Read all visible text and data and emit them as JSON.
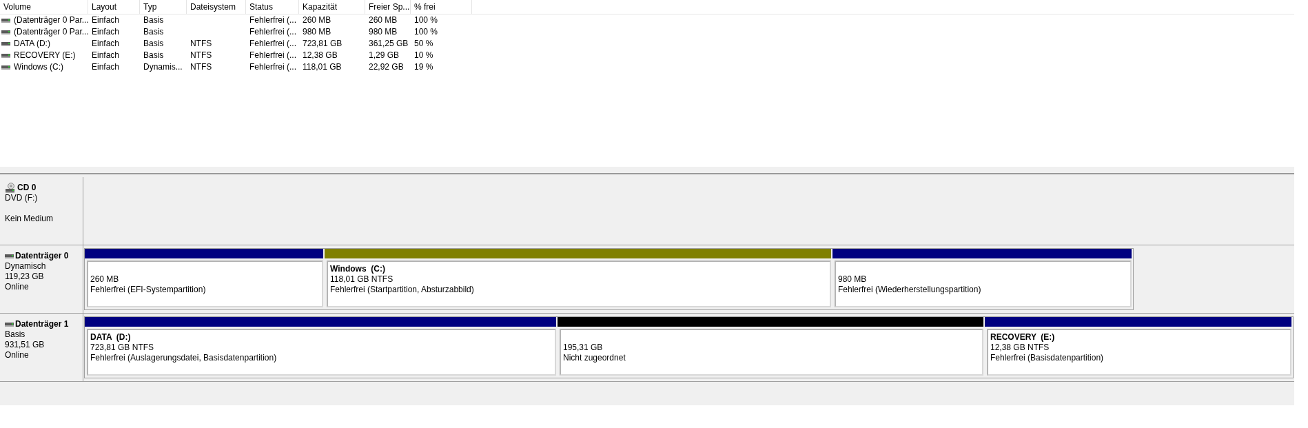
{
  "volume_table": {
    "columns": [
      "Volume",
      "Layout",
      "Typ",
      "Dateisystem",
      "Status",
      "Kapazität",
      "Freier Sp...",
      "% frei"
    ],
    "rows": [
      {
        "volume": "(Datenträger 0 Par...",
        "layout": "Einfach",
        "typ": "Basis",
        "status": "Fehlerfrei (...",
        "kapazitaet": "260 MB",
        "freier_speicher": "260 MB",
        "prozent_frei": "100 %"
      },
      {
        "volume": "(Datenträger 0 Par...",
        "layout": "Einfach",
        "typ": "Basis",
        "status": "Fehlerfrei (...",
        "kapazitaet": "980 MB",
        "freier_speicher": "980 MB",
        "prozent_frei": "100 %"
      },
      {
        "volume": "DATA (D:)",
        "layout": "Einfach",
        "typ": "Basis",
        "dateisystem": "NTFS",
        "status": "Fehlerfrei (...",
        "kapazitaet": "723,81 GB",
        "freier_speicher": "361,25 GB",
        "prozent_frei": "50 %"
      },
      {
        "volume": "RECOVERY (E:)",
        "layout": "Einfach",
        "typ": "Basis",
        "dateisystem": "NTFS",
        "status": "Fehlerfrei (...",
        "kapazitaet": "12,38 GB",
        "freier_speicher": "1,29 GB",
        "prozent_frei": "10 %"
      },
      {
        "volume": "Windows (C:)",
        "layout": "Einfach",
        "typ": "Dynamis...",
        "dateisystem": "NTFS",
        "status": "Fehlerfrei (...",
        "kapazitaet": "118,01 GB",
        "freier_speicher": "22,92 GB",
        "prozent_frei": "19 %"
      }
    ]
  },
  "disks": [
    {
      "kind": "cd",
      "name": "CD 0",
      "type": "DVD (F:)",
      "status": "Kein Medium"
    },
    {
      "kind": "disk",
      "name": "Datenträger 0",
      "type": "Dynamisch",
      "size": "119,23 GB",
      "status": "Online",
      "partitions": [
        {
          "color": "#000080",
          "size": "260 MB",
          "status": "Fehlerfrei (EFI-Systempartition)"
        },
        {
          "color": "#808000",
          "name": "Windows  (C:)",
          "size": "118,01 GB NTFS",
          "status": "Fehlerfrei (Startpartition, Absturzabbild)"
        },
        {
          "color": "#000080",
          "size": "980 MB",
          "status": "Fehlerfrei (Wiederherstellungspartition)"
        }
      ]
    },
    {
      "kind": "disk",
      "name": "Datenträger 1",
      "type": "Basis",
      "size": "931,51 GB",
      "status": "Online",
      "partitions": [
        {
          "color": "#000080",
          "name": "DATA  (D:)",
          "size": "723,81 GB NTFS",
          "status": "Fehlerfrei (Auslagerungsdatei, Basisdatenpartition)"
        },
        {
          "color": "#000000",
          "size": "195,31 GB",
          "status": "Nicht zugeordnet"
        },
        {
          "color": "#000080",
          "name": "RECOVERY  (E:)",
          "size": "12,38 GB NTFS",
          "status": "Fehlerfrei (Basisdatenpartition)"
        }
      ]
    }
  ]
}
